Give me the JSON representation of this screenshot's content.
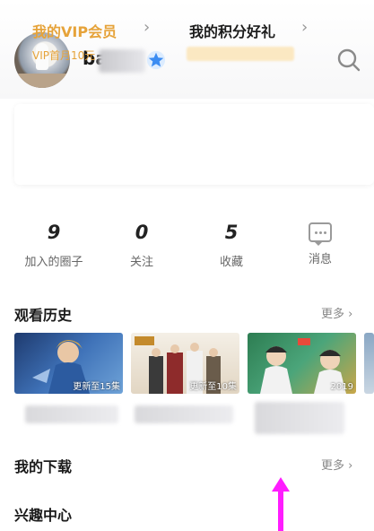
{
  "profile": {
    "username": "ba"
  },
  "vip": {
    "title": "我的VIP会员",
    "subtitle": "VIP首月10元",
    "points_title": "我的积分好礼"
  },
  "stats": [
    {
      "value": "9",
      "label": "加入的圈子"
    },
    {
      "value": "0",
      "label": "关注"
    },
    {
      "value": "5",
      "label": "收藏"
    },
    {
      "value": "",
      "label": "消息"
    }
  ],
  "history": {
    "title": "观看历史",
    "more": "更多",
    "items": [
      {
        "caption": "更新至15集"
      },
      {
        "caption": "更新至10集"
      },
      {
        "caption": "2019"
      }
    ]
  },
  "downloads": {
    "title": "我的下载",
    "more": "更多"
  },
  "interests": {
    "title": "兴趣中心"
  },
  "colors": {
    "vip_gold": "#e6a33a",
    "arrow": "#ff1dff"
  }
}
